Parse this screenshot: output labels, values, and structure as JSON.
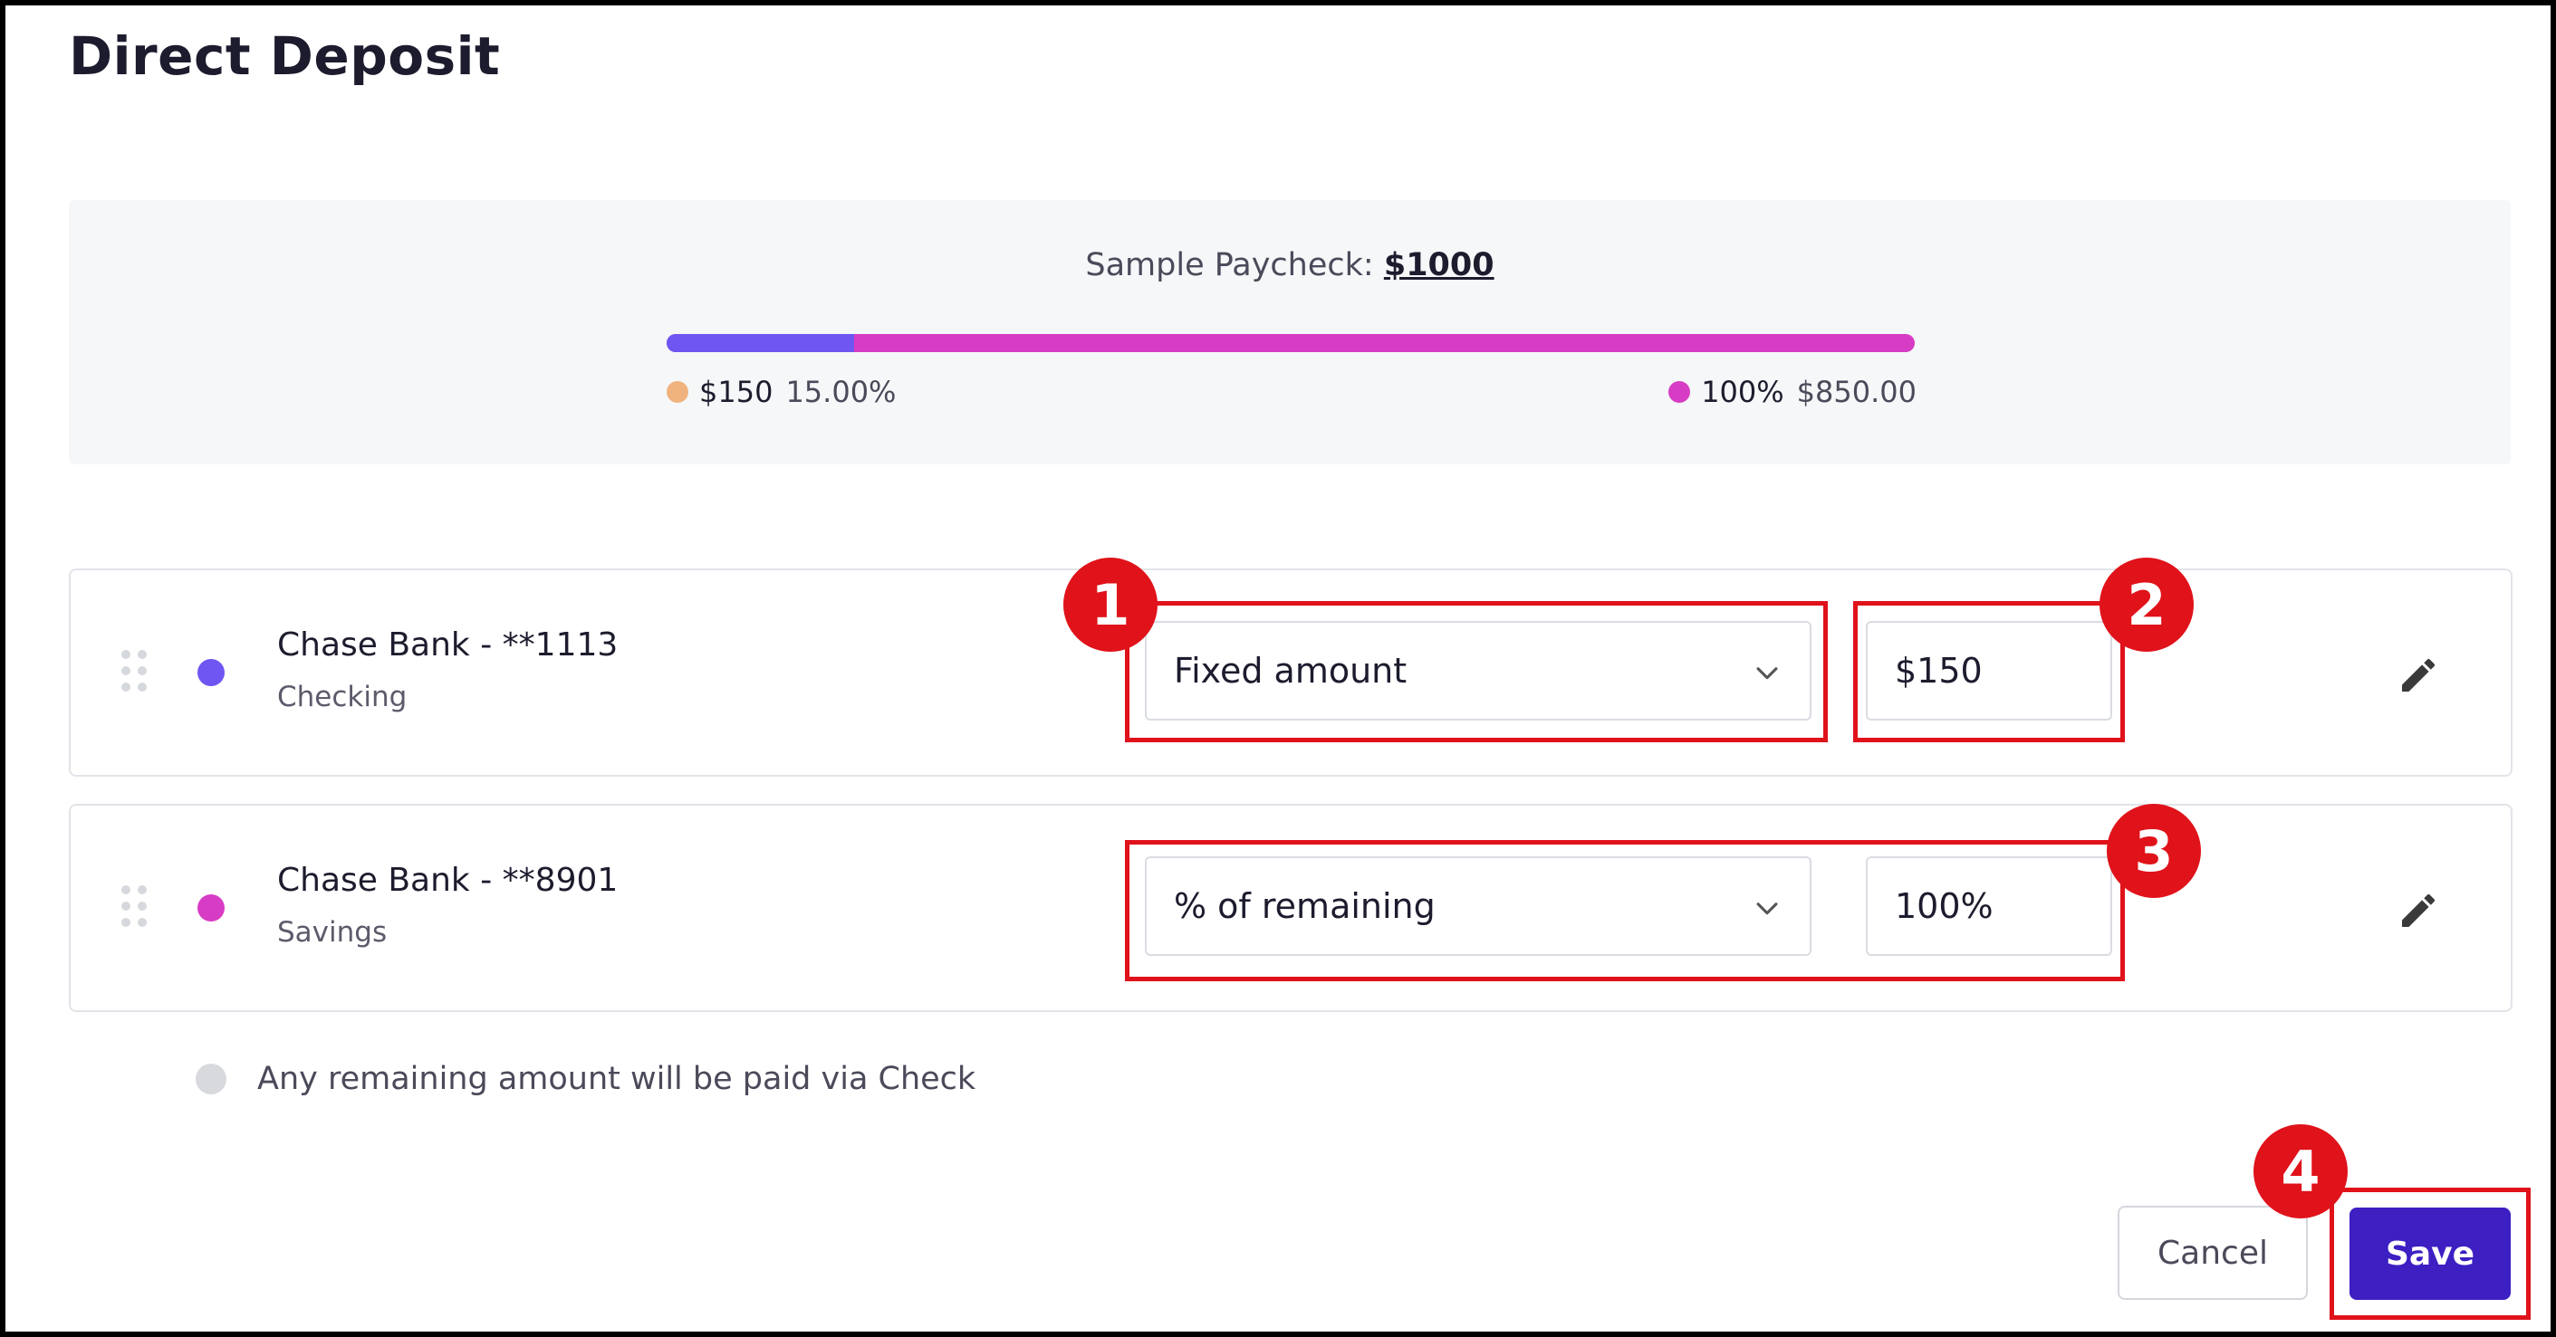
{
  "page": {
    "title": "Direct Deposit"
  },
  "summary": {
    "label": "Sample Paycheck:",
    "amount": "$1000",
    "bar": {
      "first_segment_percent": 15,
      "first_color": "#6f55f2",
      "second_color": "#d73cc4"
    },
    "left_legend": {
      "amount": "$150",
      "percent": "15.00%",
      "dot_color": "#f0b37e"
    },
    "right_legend": {
      "percent": "100%",
      "amount": "$850.00",
      "dot_color": "#d73cc4"
    }
  },
  "accounts": [
    {
      "name": "Chase Bank - **1113",
      "type": "Checking",
      "dot_color": "#6f55f2",
      "allocation_type": "Fixed amount",
      "value": "$150"
    },
    {
      "name": "Chase Bank - **8901",
      "type": "Savings",
      "dot_color": "#d73cc4",
      "allocation_type": "% of remaining",
      "value": "100%"
    }
  ],
  "remaining_note": "Any remaining amount will be paid via Check",
  "buttons": {
    "cancel": "Cancel",
    "save": "Save"
  },
  "annotations": [
    "1",
    "2",
    "3",
    "4"
  ],
  "icons": {
    "drag": "drag-handle-icon",
    "chevron": "chevron-down-icon",
    "edit": "pencil-icon"
  }
}
